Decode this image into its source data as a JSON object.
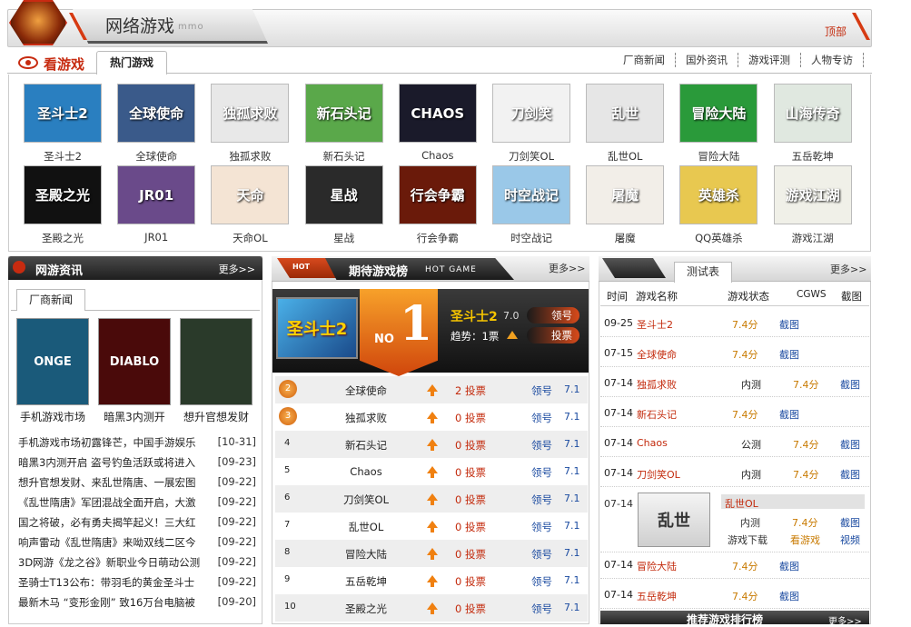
{
  "header": {
    "site_title": "网络游戏",
    "site_sub": "mmo",
    "top_link": "顶部"
  },
  "tabs": {
    "kan": "看游戏",
    "hot": "热门游戏",
    "links": [
      "厂商新闻",
      "国外资讯",
      "游戏评测",
      "人物专访"
    ]
  },
  "games": [
    {
      "name": "圣斗士2",
      "thumb": "圣斗士2",
      "color": "#2a7fc0"
    },
    {
      "name": "全球使命",
      "thumb": "全球使命",
      "color": "#3a5a8a"
    },
    {
      "name": "独孤求败",
      "thumb": "独孤求败",
      "color": "#e8e8e8"
    },
    {
      "name": "新石头记",
      "thumb": "新石头记",
      "color": "#5aa84a"
    },
    {
      "name": "Chaos",
      "thumb": "CHAOS",
      "color": "#1a1a2a"
    },
    {
      "name": "刀剑笑OL",
      "thumb": "刀剑笑",
      "color": "#f2f2f2"
    },
    {
      "name": "乱世OL",
      "thumb": "乱世",
      "color": "#e6e6e6"
    },
    {
      "name": "冒险大陆",
      "thumb": "冒险大陆",
      "color": "#2a9a3a"
    },
    {
      "name": "五岳乾坤",
      "thumb": "山海传奇",
      "color": "#e0e8e0"
    },
    {
      "name": "圣殿之光",
      "thumb": "圣殿之光",
      "color": "#111111"
    },
    {
      "name": "JR01",
      "thumb": "JR01",
      "color": "#6a4a8a"
    },
    {
      "name": "天命OL",
      "thumb": "天命",
      "color": "#f4e4d4"
    },
    {
      "name": "星战",
      "thumb": "星战",
      "color": "#2a2a2a"
    },
    {
      "name": "行会争霸",
      "thumb": "行会争霸",
      "color": "#6a1a0a"
    },
    {
      "name": "时空战记",
      "thumb": "时空战记",
      "color": "#9ac8e8"
    },
    {
      "name": "屠魔",
      "thumb": "屠魔",
      "color": "#f2eee8"
    },
    {
      "name": "QQ英雄杀",
      "thumb": "英雄杀",
      "color": "#e8c850"
    },
    {
      "name": "游戏江湖",
      "thumb": "游戏江湖",
      "color": "#f0f0e8"
    }
  ],
  "left_panel": {
    "title": "网游资讯",
    "more": "更多>>",
    "tab": "厂商新闻",
    "pics": [
      {
        "caption": "手机游戏市场",
        "thumb": "ONGE",
        "color": "#1a5a7a"
      },
      {
        "caption": "暗黑3内测开",
        "thumb": "DIABLO",
        "color": "#4a0a0a"
      },
      {
        "caption": "想升官想发财",
        "thumb": "",
        "color": "#2a3a2a"
      }
    ],
    "news": [
      {
        "text": "手机游戏市场初露锋芒，中国手游娱乐",
        "date": "[10-31]"
      },
      {
        "text": "暗黑3内测开启 盗号钓鱼活跃或将进入",
        "date": "[09-23]"
      },
      {
        "text": "想升官想发财、来乱世隋唐、一展宏图",
        "date": "[09-22]"
      },
      {
        "text": "《乱世隋唐》军团混战全面开启，大激",
        "date": "[09-22]"
      },
      {
        "text": "国之将破，必有勇夫揭竿起义！三大红",
        "date": "[09-22]"
      },
      {
        "text": "响声雷动《乱世隋唐》来呦双线二区今",
        "date": "[09-22]"
      },
      {
        "text": "3D网游《龙之谷》新职业今日萌动公测",
        "date": "[09-22]"
      },
      {
        "text": "圣骑士T13公布：带羽毛的黄金圣斗士",
        "date": "[09-22]"
      },
      {
        "text": "最新木马 “变形金刚” 致16万台电脑被",
        "date": "[09-20]"
      }
    ]
  },
  "mid_panel": {
    "hot_tag": "HOT",
    "title": "期待游戏榜",
    "sub": "HOT GAME",
    "more": "更多>>",
    "top": {
      "badge_text": "NO",
      "badge_num": "1",
      "thumb": "圣斗士2",
      "name": "圣斗士2",
      "score": "7.0",
      "trend": "趋势：1票",
      "btn_get": "领号",
      "btn_vote": "投票"
    },
    "rows": [
      {
        "rank": "2",
        "name": "全球使命",
        "votes": "2 投票",
        "get": "领号",
        "score": "7.1"
      },
      {
        "rank": "3",
        "name": "独孤求败",
        "votes": "0 投票",
        "get": "领号",
        "score": "7.1"
      },
      {
        "rank": "4",
        "name": "新石头记",
        "votes": "0 投票",
        "get": "领号",
        "score": "7.1"
      },
      {
        "rank": "5",
        "name": "Chaos",
        "votes": "0 投票",
        "get": "领号",
        "score": "7.1"
      },
      {
        "rank": "6",
        "name": "刀剑笑OL",
        "votes": "0 投票",
        "get": "领号",
        "score": "7.1"
      },
      {
        "rank": "7",
        "name": "乱世OL",
        "votes": "0 投票",
        "get": "领号",
        "score": "7.1"
      },
      {
        "rank": "8",
        "name": "冒险大陆",
        "votes": "0 投票",
        "get": "领号",
        "score": "7.1"
      },
      {
        "rank": "9",
        "name": "五岳乾坤",
        "votes": "0 投票",
        "get": "领号",
        "score": "7.1"
      },
      {
        "rank": "10",
        "name": "圣殿之光",
        "votes": "0 投票",
        "get": "领号",
        "score": "7.1"
      }
    ]
  },
  "right_panel": {
    "tab": "测试表",
    "more": "更多>>",
    "headers": [
      "时间",
      "游戏名称",
      "游戏状态",
      "CGWS",
      "截图"
    ],
    "rows": [
      {
        "date": "09-25",
        "name": "圣斗士2",
        "status": "",
        "score": "7.4分",
        "shot": "截图"
      },
      {
        "date": "07-15",
        "name": "全球使命",
        "status": "",
        "score": "7.4分",
        "shot": "截图"
      },
      {
        "date": "07-14",
        "name": "独孤求败",
        "status": "内测",
        "score": "7.4分",
        "shot": "截图"
      },
      {
        "date": "07-14",
        "name": "新石头记",
        "status": "",
        "score": "7.4分",
        "shot": "截图"
      },
      {
        "date": "07-14",
        "name": "Chaos",
        "status": "公测",
        "score": "7.4分",
        "shot": "截图"
      },
      {
        "date": "07-14",
        "name": "刀剑笑OL",
        "status": "内测",
        "score": "7.4分",
        "shot": "截图"
      }
    ],
    "featured": {
      "date": "07-14",
      "name": "乱世OL",
      "thumb": "乱世",
      "status": "内测",
      "score": "7.4分",
      "shot": "截图",
      "download": "游戏下载",
      "view": "看游戏",
      "video": "视频"
    },
    "rows2": [
      {
        "date": "07-14",
        "name": "冒险大陆",
        "score": "7.4分",
        "shot": "截图"
      },
      {
        "date": "07-14",
        "name": "五岳乾坤",
        "score": "7.4分",
        "shot": "截图"
      }
    ],
    "bottom_title": "推荐游戏排行榜",
    "bottom_more": "更多>>"
  }
}
